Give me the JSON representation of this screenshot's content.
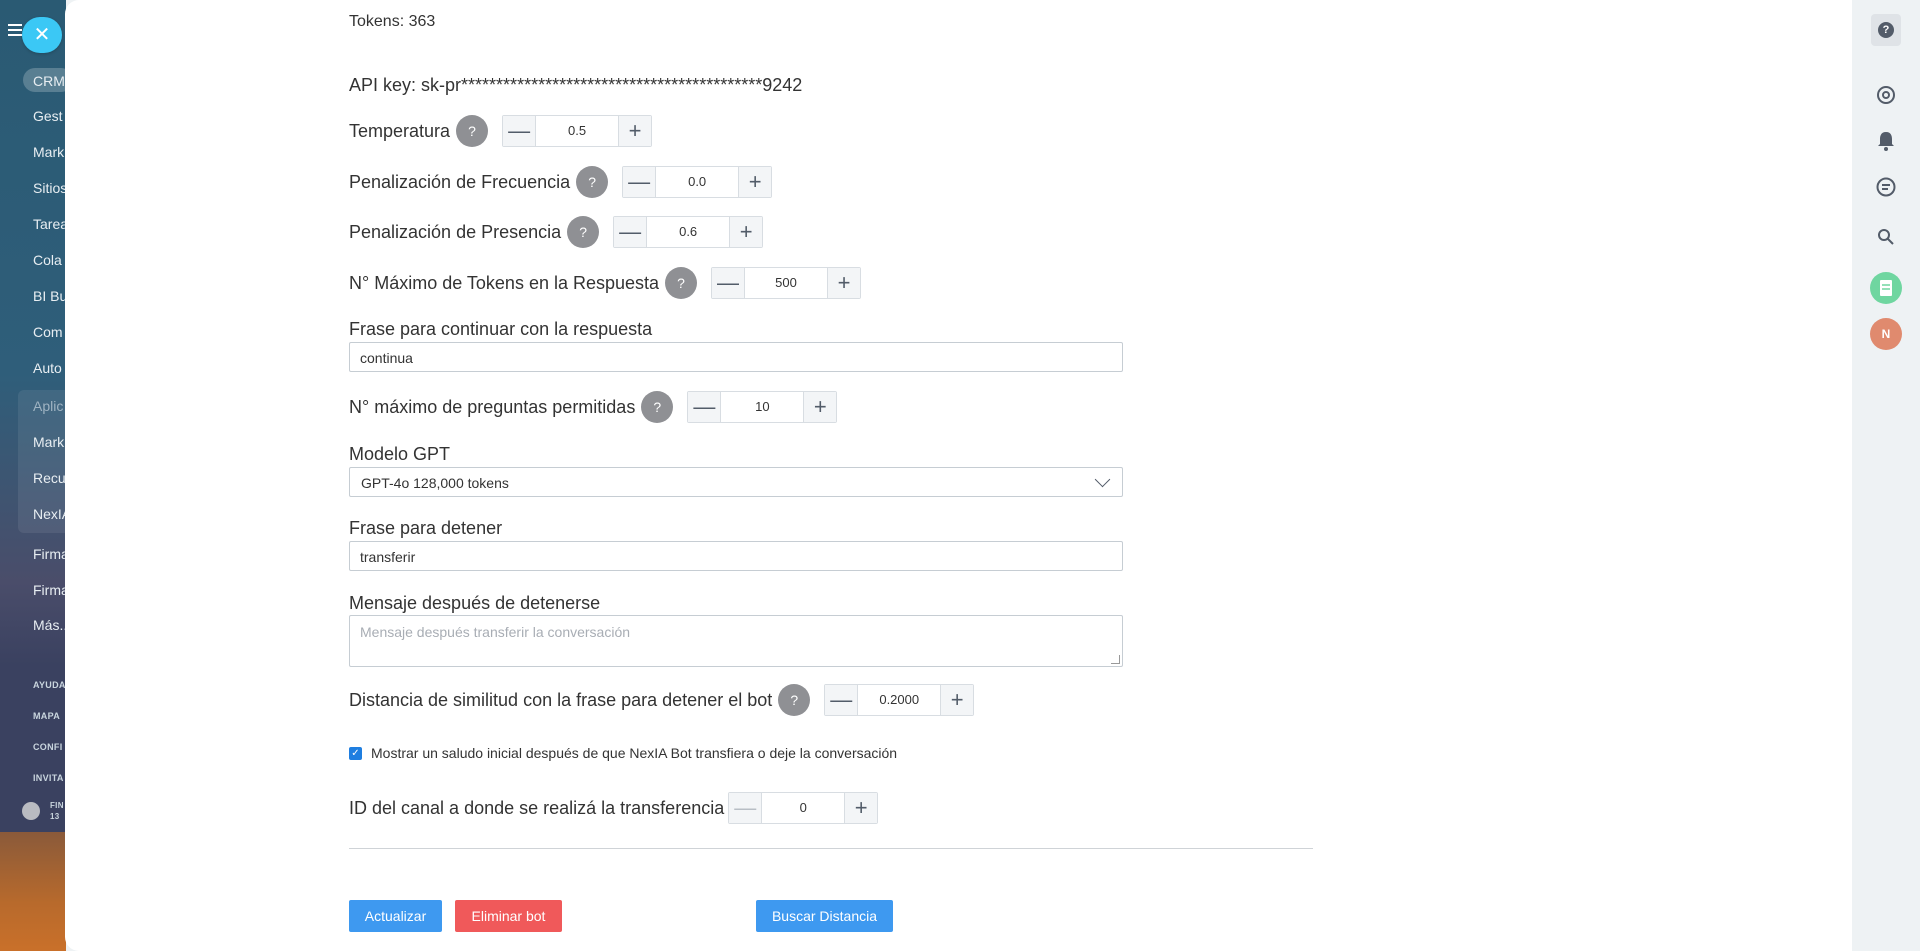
{
  "background_sidebar": {
    "pill_label": "CRM",
    "items": [
      "Gest",
      "Mark",
      "Sitios",
      "Tarea",
      "Cola",
      "BI Bu",
      "Com",
      "Auto",
      "Aplic",
      "Mark",
      "Recu",
      "NexIA",
      "Firma",
      "Firma",
      "Más..."
    ],
    "small_items": [
      "AYUDA",
      "MAPA",
      "CONFI",
      "INVITA"
    ],
    "plan_text": "FIN\n13"
  },
  "form": {
    "tokens_text": "Tokens: 363",
    "api_key_text": "API key: sk-pr*******************************************9242",
    "temperature": {
      "label": "Temperatura",
      "help": "?",
      "value": "0.5"
    },
    "frequency_penalty": {
      "label": "Penalización de Frecuencia",
      "help": "?",
      "value": "0.0"
    },
    "presence_penalty": {
      "label": "Penalización de Presencia",
      "help": "?",
      "value": "0.6"
    },
    "max_tokens": {
      "label": "N° Máximo de Tokens en la Respuesta",
      "help": "?",
      "value": "500"
    },
    "continue_phrase": {
      "label": "Frase para continuar con la respuesta",
      "value": "continua"
    },
    "max_questions": {
      "label": "N° máximo de preguntas permitidas",
      "help": "?",
      "value": "10"
    },
    "gpt_model": {
      "label": "Modelo GPT",
      "selected": "GPT-4o 128,000 tokens"
    },
    "stop_phrase": {
      "label": "Frase para detener",
      "value": "transferir"
    },
    "after_stop_message": {
      "label": "Mensaje después de detenerse",
      "placeholder": "Mensaje después transferir la conversación"
    },
    "similarity_distance": {
      "label": "Distancia de similitud con la frase para detener el bot",
      "help": "?",
      "value": "0.2000"
    },
    "initial_greeting": {
      "label": "Mostrar un saludo inicial después de que NexIA Bot transfiera o deje la conversación",
      "checked": true
    },
    "transfer_channel": {
      "label": "ID del canal a donde se realizá la transferencia",
      "value": "0"
    }
  },
  "buttons": {
    "update": "Actualizar",
    "delete": "Eliminar bot",
    "search_distance": "Buscar Distancia"
  },
  "right_bar": {
    "help": "?",
    "avatar": "N"
  },
  "colors": {
    "primary": "#3e99f0",
    "danger": "#f0595a",
    "close_button": "#3bc8f5"
  }
}
